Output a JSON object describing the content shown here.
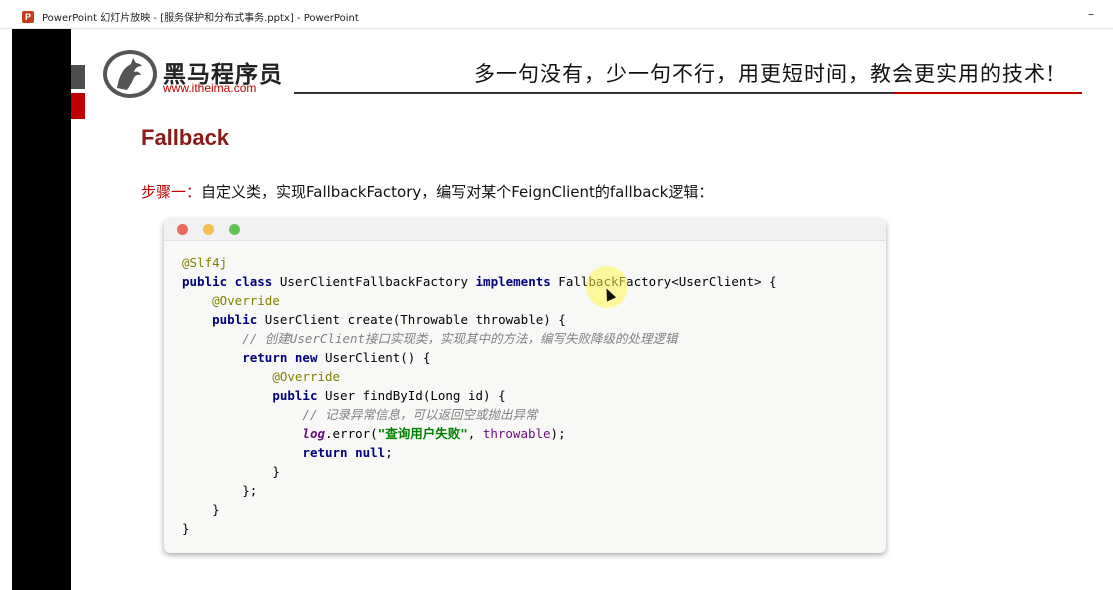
{
  "window": {
    "title": "PowerPoint 幻灯片放映 - [服务保护和分布式事务.pptx] - PowerPoint",
    "minimize": "–"
  },
  "slide": {
    "logo": {
      "name": "黑马程序员",
      "url": "www.itheima.com"
    },
    "slogan": "多一句没有，少一句不行，用更短时间，教会更实用的技术!",
    "heading": "Fallback",
    "step_label": "步骤一：",
    "step_text": "自定义类，实现FallbackFactory，编写对某个FeignClient的fallback逻辑："
  },
  "code": {
    "l1": "@Slf4j",
    "l2_kw1": "public class",
    "l2_name": " UserClientFallbackFactory ",
    "l2_kw2": "implements",
    "l2_rest": " FallbackFactory<UserClient> {",
    "l3": "@Override",
    "l4_kw": "public",
    "l4_rest": " UserClient create(Throwable throwable) {",
    "l5": "// 创建UserClient接口实现类，实现其中的方法，编写失败降级的处理逻辑",
    "l6_kw1": "return",
    "l6_kw2": "new",
    "l6_rest": " UserClient() {",
    "l7": "@Override",
    "l8_kw": "public",
    "l8_rest": " User findById(Long id) {",
    "l9": "// 记录异常信息，可以返回空或抛出异常",
    "l10_fld": "log",
    "l10_mid": ".error(",
    "l10_str": "\"查询用户失败\"",
    "l10_comma": ", ",
    "l10_prm": "throwable",
    "l10_end": ");",
    "l11_kw1": "return",
    "l11_kw2": "null",
    "l11_end": ";",
    "l12": "}",
    "l13": "};",
    "l14": "}",
    "l15": "}"
  }
}
